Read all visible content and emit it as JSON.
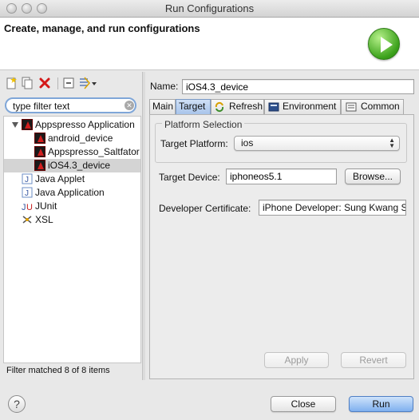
{
  "window": {
    "title": "Run Configurations"
  },
  "header": {
    "title": "Create, manage, and run configurations"
  },
  "filter": {
    "value": "type filter text",
    "status": "Filter matched 8 of 8 items"
  },
  "tree": {
    "items": [
      {
        "label": "Appspresso Application",
        "icon": "appspresso-icon"
      },
      {
        "label": "android_device",
        "icon": "appspresso-icon"
      },
      {
        "label": "Appspresso_Saltfator",
        "icon": "appspresso-icon"
      },
      {
        "label": "iOS4.3_device",
        "icon": "appspresso-icon"
      },
      {
        "label": "Java Applet",
        "icon": "java-applet-icon"
      },
      {
        "label": "Java Application",
        "icon": "java-application-icon"
      },
      {
        "label": "JUnit",
        "icon": "junit-icon"
      },
      {
        "label": "XSL",
        "icon": "xsl-icon"
      }
    ]
  },
  "form": {
    "name_label": "Name:",
    "name_value": "iOS4.3_device"
  },
  "tabs": [
    {
      "label": "Main"
    },
    {
      "label": "Target"
    },
    {
      "label": "Refresh"
    },
    {
      "label": "Environment"
    },
    {
      "label": "Common"
    }
  ],
  "target": {
    "group_title": "Platform Selection",
    "platform_label": "Target Platform:",
    "platform_value": "ios",
    "device_label": "Target Device:",
    "device_value": "iphoneos5.1",
    "browse_label": "Browse...",
    "cert_label": "Developer Certificate:",
    "cert_value": "iPhone Developer: Sung Kwang Se"
  },
  "buttons": {
    "apply": "Apply",
    "revert": "Revert",
    "close": "Close",
    "run": "Run",
    "help": "?"
  },
  "colors": {
    "accent": "#7fb0ef",
    "run_green": "#3aa11a",
    "brand_red": "#d21e1e"
  }
}
